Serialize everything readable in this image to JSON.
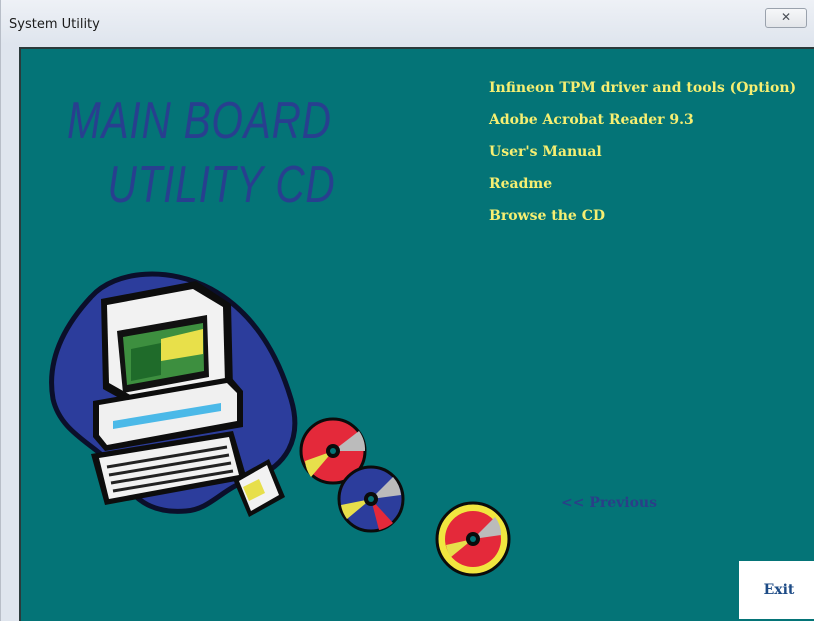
{
  "window": {
    "title": "System Utility",
    "close_glyph": "✕"
  },
  "banner": {
    "line1": "MAIN BOARD",
    "line2": "UTILITY  CD"
  },
  "menu": {
    "items": [
      {
        "label": "Infineon TPM driver and tools (Option)"
      },
      {
        "label": "Adobe Acrobat Reader 9.3"
      },
      {
        "label": "User's Manual"
      },
      {
        "label": "Readme"
      },
      {
        "label": "Browse the CD"
      }
    ]
  },
  "nav": {
    "previous_label": "<< Previous",
    "exit_label": "Exit"
  },
  "colors": {
    "background": "#047477",
    "menu_text": "#f6ef72",
    "banner_text": "#283f8f",
    "previous_text": "#2a3f88"
  },
  "icons": [
    "computer-illustration",
    "cd-disc-red-icon",
    "cd-disc-blue-icon",
    "cd-disc-yellow-icon",
    "floppy-disk-icon"
  ]
}
